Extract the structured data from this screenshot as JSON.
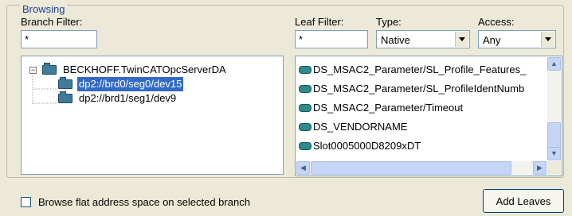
{
  "group": {
    "title": "Browsing"
  },
  "branch_filter": {
    "label": "Branch Filter:",
    "value": "*"
  },
  "leaf_filter": {
    "label": "Leaf Filter:",
    "value": "*"
  },
  "type": {
    "label": "Type:",
    "selected": "Native"
  },
  "access": {
    "label": "Access:",
    "selected": "Any"
  },
  "tree": {
    "root": "BECKHOFF.TwinCATOpcServerDA",
    "children": [
      "dp2://brd0/seg0/dev15",
      "dp2://brd1/seg1/dev9"
    ],
    "selected_index": 0
  },
  "leaves": [
    "DS_MSAC2_Parameter/SL_Profile_Features_",
    "DS_MSAC2_Parameter/SL_ProfileIdentNumb",
    "DS_MSAC2_Parameter/Timeout",
    "DS_VENDORNAME",
    "Slot0005000D8209xDT"
  ],
  "flat_browse": {
    "label": "Browse flat address space on selected branch",
    "checked": false
  },
  "add_leaves_button": {
    "label": "Add Leaves"
  }
}
